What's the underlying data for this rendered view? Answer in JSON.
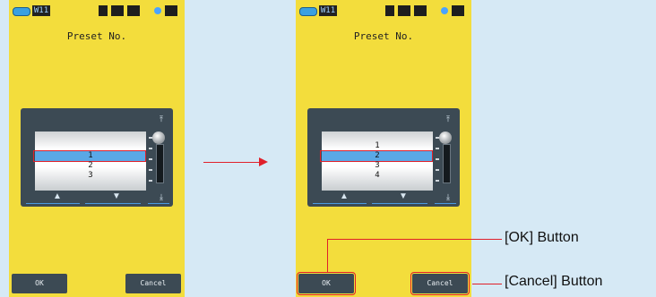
{
  "screens": [
    {
      "status_chip": "W11",
      "title": "Preset No.",
      "list_items": [
        "",
        "1",
        "2",
        "3"
      ],
      "selected_index": 1,
      "ok_label": "OK",
      "cancel_label": "Cancel"
    },
    {
      "status_chip": "W11",
      "title": "Preset No.",
      "list_items": [
        "1",
        "2",
        "3",
        "4"
      ],
      "selected_index": 1,
      "ok_label": "OK",
      "cancel_label": "Cancel"
    }
  ],
  "picker_buttons": {
    "up_icon": "▲",
    "down_icon": "▼",
    "top_icon": "⤒",
    "bottom_icon": "⤓"
  },
  "callouts": {
    "ok": "[OK] Button",
    "cancel": "[Cancel] Button"
  },
  "colors": {
    "screen_bg": "#f3dd3c",
    "page_bg": "#d6e9f5",
    "highlight": "#e0202a",
    "selection": "#5aa8e6"
  }
}
